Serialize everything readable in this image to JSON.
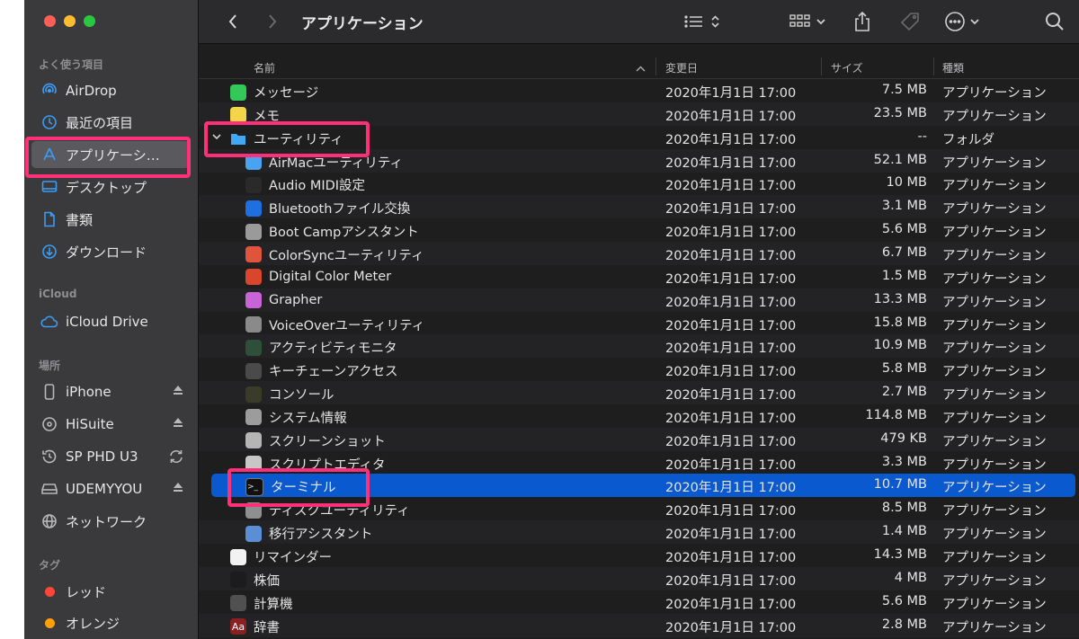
{
  "window": {
    "title": "アプリケーション"
  },
  "sidebar": {
    "sections": [
      {
        "heading": "よく使う項目",
        "items": [
          {
            "label": "AirDrop",
            "icon": "airdrop-icon"
          },
          {
            "label": "最近の項目",
            "icon": "clock-icon"
          },
          {
            "label": "アプリケーシ…",
            "icon": "applications-icon",
            "selected": true
          },
          {
            "label": "デスクトップ",
            "icon": "desktop-icon"
          },
          {
            "label": "書類",
            "icon": "document-icon"
          },
          {
            "label": "ダウンロード",
            "icon": "download-icon"
          }
        ]
      },
      {
        "heading": "iCloud",
        "items": [
          {
            "label": "iCloud Drive",
            "icon": "cloud-icon"
          }
        ]
      },
      {
        "heading": "場所",
        "items": [
          {
            "label": "iPhone",
            "icon": "iphone-icon",
            "eject": true
          },
          {
            "label": "HiSuite",
            "icon": "disk-icon",
            "eject": true
          },
          {
            "label": "SP PHD U3",
            "icon": "clock-disk-icon",
            "sync": true
          },
          {
            "label": "UDEMYYOU",
            "icon": "external-drive-icon",
            "eject": true
          },
          {
            "label": "ネットワーク",
            "icon": "network-icon"
          }
        ]
      },
      {
        "heading": "タグ",
        "items": [
          {
            "label": "レッド",
            "color": "#ff453a"
          },
          {
            "label": "オレンジ",
            "color": "#ff9f0a"
          }
        ]
      }
    ]
  },
  "toolbar": {
    "back_icon": "chevron-left-icon",
    "forward_icon": "chevron-right-icon",
    "view_icon": "list-view-icon",
    "group_icon": "grid-group-icon",
    "share_icon": "share-icon",
    "tag_icon": "tag-icon",
    "action_icon": "more-icon",
    "search_icon": "search-icon"
  },
  "columns": {
    "name": "名前",
    "date": "変更日",
    "size": "サイズ",
    "kind": "種類"
  },
  "files": [
    {
      "name": "メッセージ",
      "date": "2020年1月1日 17:00",
      "size": "7.5 MB",
      "kind": "アプリケーション",
      "indent": 0,
      "icon_color": "#34c759"
    },
    {
      "name": "メモ",
      "date": "2020年1月1日 17:00",
      "size": "23.5 MB",
      "kind": "アプリケーション",
      "indent": 0,
      "icon_color": "#f5d548"
    },
    {
      "name": "ユーティリティ",
      "date": "2020年1月1日 17:00",
      "size": "--",
      "kind": "フォルダ",
      "indent": 0,
      "folder": true,
      "icon_color": "#3fa9f5"
    },
    {
      "name": "AirMacユーティリティ",
      "date": "2020年1月1日 17:00",
      "size": "52.1 MB",
      "kind": "アプリケーション",
      "indent": 1,
      "icon_color": "#4aa3f0"
    },
    {
      "name": "Audio MIDI設定",
      "date": "2020年1月1日 17:00",
      "size": "10 MB",
      "kind": "アプリケーション",
      "indent": 1,
      "icon_color": "#2a2a2a"
    },
    {
      "name": "Bluetoothファイル交換",
      "date": "2020年1月1日 17:00",
      "size": "3.1 MB",
      "kind": "アプリケーション",
      "indent": 1,
      "icon_color": "#1e6fe0"
    },
    {
      "name": "Boot Campアシスタント",
      "date": "2020年1月1日 17:00",
      "size": "5.6 MB",
      "kind": "アプリケーション",
      "indent": 1,
      "icon_color": "#9a9a9a"
    },
    {
      "name": "ColorSyncユーティリティ",
      "date": "2020年1月1日 17:00",
      "size": "6.7 MB",
      "kind": "アプリケーション",
      "indent": 1,
      "icon_color": "#e0533d"
    },
    {
      "name": "Digital Color Meter",
      "date": "2020年1月1日 17:00",
      "size": "1.5 MB",
      "kind": "アプリケーション",
      "indent": 1,
      "icon_color": "#d9462b"
    },
    {
      "name": "Grapher",
      "date": "2020年1月1日 17:00",
      "size": "13.3 MB",
      "kind": "アプリケーション",
      "indent": 1,
      "icon_color": "#c864d8"
    },
    {
      "name": "VoiceOverユーティリティ",
      "date": "2020年1月1日 17:00",
      "size": "15.8 MB",
      "kind": "アプリケーション",
      "indent": 1,
      "icon_color": "#8a8a8a"
    },
    {
      "name": "アクティビティモニタ",
      "date": "2020年1月1日 17:00",
      "size": "10.9 MB",
      "kind": "アプリケーション",
      "indent": 1,
      "icon_color": "#2e4f3a"
    },
    {
      "name": "キーチェーンアクセス",
      "date": "2020年1月1日 17:00",
      "size": "5.8 MB",
      "kind": "アプリケーション",
      "indent": 1,
      "icon_color": "#4a4a4a"
    },
    {
      "name": "コンソール",
      "date": "2020年1月1日 17:00",
      "size": "2.7 MB",
      "kind": "アプリケーション",
      "indent": 1,
      "icon_color": "#3b3b2a"
    },
    {
      "name": "システム情報",
      "date": "2020年1月1日 17:00",
      "size": "114.8 MB",
      "kind": "アプリケーション",
      "indent": 1,
      "icon_color": "#9c9c9c"
    },
    {
      "name": "スクリーンショット",
      "date": "2020年1月1日 17:00",
      "size": "479 KB",
      "kind": "アプリケーション",
      "indent": 1,
      "icon_color": "#b5b5b5"
    },
    {
      "name": "スクリプトエディタ",
      "date": "2020年1月1日 17:00",
      "size": "3.3 MB",
      "kind": "アプリケーション",
      "indent": 1,
      "icon_color": "#c7c7c7"
    },
    {
      "name": "ターミナル",
      "date": "2020年1月1日 17:00",
      "size": "10.7 MB",
      "kind": "アプリケーション",
      "indent": 1,
      "icon_color": "#111111",
      "selected": true
    },
    {
      "name": "ディスクユーティリティ",
      "date": "2020年1月1日 17:00",
      "size": "8.5 MB",
      "kind": "アプリケーション",
      "indent": 1,
      "icon_color": "#8f8f8f"
    },
    {
      "name": "移行アシスタント",
      "date": "2020年1月1日 17:00",
      "size": "1.4 MB",
      "kind": "アプリケーション",
      "indent": 1,
      "icon_color": "#5a8fd6"
    },
    {
      "name": "リマインダー",
      "date": "2020年1月1日 17:00",
      "size": "14.3 MB",
      "kind": "アプリケーション",
      "indent": 0,
      "icon_color": "#f2f2f2"
    },
    {
      "name": "株価",
      "date": "2020年1月1日 17:00",
      "size": "4 MB",
      "kind": "アプリケーション",
      "indent": 0,
      "icon_color": "#1c1c1e"
    },
    {
      "name": "計算機",
      "date": "2020年1月1日 17:00",
      "size": "5.6 MB",
      "kind": "アプリケーション",
      "indent": 0,
      "icon_color": "#505050"
    },
    {
      "name": "辞書",
      "date": "2020年1月1日 17:00",
      "size": "2.8 MB",
      "kind": "アプリケーション",
      "indent": 0,
      "icon_color": "#8b2020",
      "icon_text": "Aa"
    }
  ],
  "accent": {
    "selection": "#0a59cf",
    "highlight_box": "#ff2f78"
  }
}
